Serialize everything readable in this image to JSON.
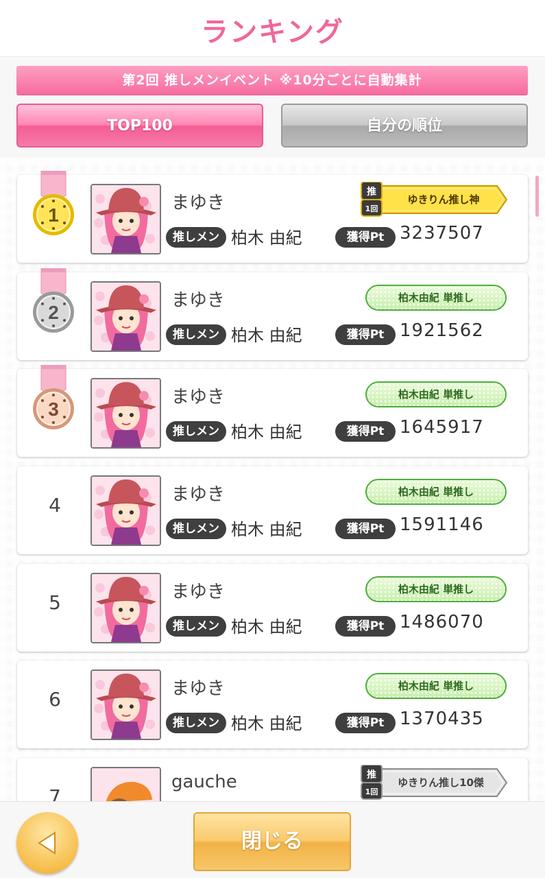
{
  "header": {
    "title": "ランキング"
  },
  "event_banner": "第2回 推しメンイベント ※10分ごとに自動集計",
  "tabs": [
    {
      "label": "TOP100",
      "active": true
    },
    {
      "label": "自分の順位",
      "active": false
    }
  ],
  "labels": {
    "oshi_tag": "推しメン",
    "points_tag": "獲得Pt"
  },
  "rankings": [
    {
      "rank": "1",
      "medal": "gold",
      "name": "まゆき",
      "member": "柏木 由紀",
      "points": "3237507",
      "badge": {
        "type": "gold",
        "text": "ゆきりん推し神",
        "icon_top": "推",
        "icon_bottom": "1回"
      }
    },
    {
      "rank": "2",
      "medal": "silver",
      "name": "まゆき",
      "member": "柏木 由紀",
      "points": "1921562",
      "badge": {
        "type": "green",
        "text": "柏木由紀 単推し"
      }
    },
    {
      "rank": "3",
      "medal": "bronze",
      "name": "まゆき",
      "member": "柏木 由紀",
      "points": "1645917",
      "badge": {
        "type": "green",
        "text": "柏木由紀 単推し"
      }
    },
    {
      "rank": "4",
      "name": "まゆき",
      "member": "柏木 由紀",
      "points": "1591146",
      "badge": {
        "type": "green",
        "text": "柏木由紀 単推し"
      }
    },
    {
      "rank": "5",
      "name": "まゆき",
      "member": "柏木 由紀",
      "points": "1486070",
      "badge": {
        "type": "green",
        "text": "柏木由紀 単推し"
      }
    },
    {
      "rank": "6",
      "name": "まゆき",
      "member": "柏木 由紀",
      "points": "1370435",
      "badge": {
        "type": "green",
        "text": "柏木由紀 単推し"
      }
    },
    {
      "rank": "7",
      "name": "gauche",
      "badge": {
        "type": "silver",
        "text": "ゆきりん推し10傑",
        "icon_top": "推",
        "icon_bottom": "1回"
      }
    }
  ],
  "footer": {
    "back_icon": "triangle-left-icon",
    "close_label": "閉じる"
  },
  "colors": {
    "accent_pink": "#f0679b",
    "gold": "#f7d21e",
    "green": "#4dae3a",
    "button_orange": "#f2b245"
  }
}
